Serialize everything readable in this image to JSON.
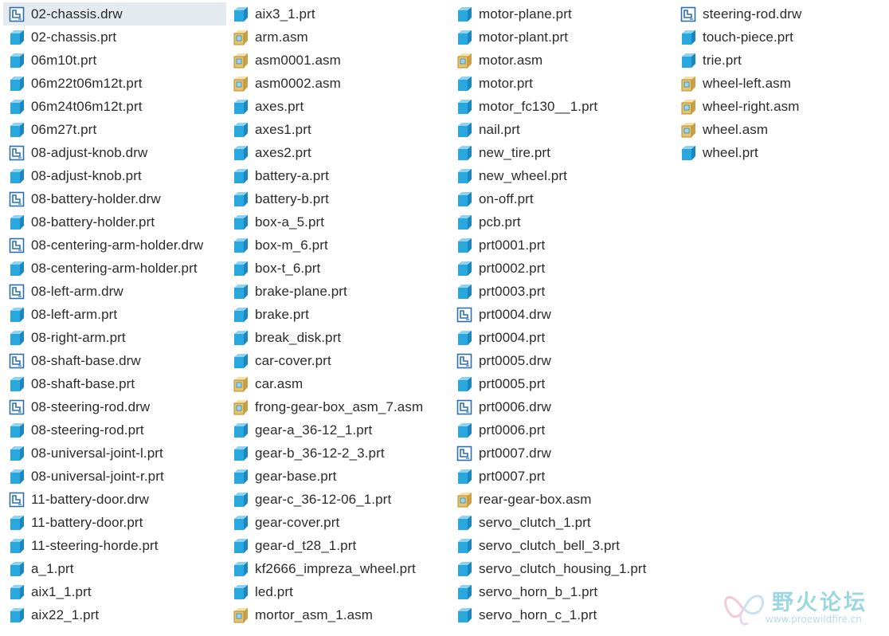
{
  "columns": [
    {
      "items": [
        {
          "name": "02-chassis.drw",
          "type": "drw",
          "selected": true
        },
        {
          "name": "02-chassis.prt",
          "type": "prt"
        },
        {
          "name": "06m10t.prt",
          "type": "prt"
        },
        {
          "name": "06m22t06m12t.prt",
          "type": "prt"
        },
        {
          "name": "06m24t06m12t.prt",
          "type": "prt"
        },
        {
          "name": "06m27t.prt",
          "type": "prt"
        },
        {
          "name": "08-adjust-knob.drw",
          "type": "drw"
        },
        {
          "name": "08-adjust-knob.prt",
          "type": "prt"
        },
        {
          "name": "08-battery-holder.drw",
          "type": "drw"
        },
        {
          "name": "08-battery-holder.prt",
          "type": "prt"
        },
        {
          "name": "08-centering-arm-holder.drw",
          "type": "drw"
        },
        {
          "name": "08-centering-arm-holder.prt",
          "type": "prt"
        },
        {
          "name": "08-left-arm.drw",
          "type": "drw"
        },
        {
          "name": "08-left-arm.prt",
          "type": "prt"
        },
        {
          "name": "08-right-arm.prt",
          "type": "prt"
        },
        {
          "name": "08-shaft-base.drw",
          "type": "drw"
        },
        {
          "name": "08-shaft-base.prt",
          "type": "prt"
        },
        {
          "name": "08-steering-rod.drw",
          "type": "drw"
        },
        {
          "name": "08-steering-rod.prt",
          "type": "prt"
        },
        {
          "name": "08-universal-joint-l.prt",
          "type": "prt"
        },
        {
          "name": "08-universal-joint-r.prt",
          "type": "prt"
        },
        {
          "name": "11-battery-door.drw",
          "type": "drw"
        },
        {
          "name": "11-battery-door.prt",
          "type": "prt"
        },
        {
          "name": "11-steering-horde.prt",
          "type": "prt"
        },
        {
          "name": "a_1.prt",
          "type": "prt"
        },
        {
          "name": "aix1_1.prt",
          "type": "prt"
        },
        {
          "name": "aix22_1.prt",
          "type": "prt"
        }
      ]
    },
    {
      "items": [
        {
          "name": "aix3_1.prt",
          "type": "prt"
        },
        {
          "name": "arm.asm",
          "type": "asm"
        },
        {
          "name": "asm0001.asm",
          "type": "asm"
        },
        {
          "name": "asm0002.asm",
          "type": "asm"
        },
        {
          "name": "axes.prt",
          "type": "prt"
        },
        {
          "name": "axes1.prt",
          "type": "prt"
        },
        {
          "name": "axes2.prt",
          "type": "prt"
        },
        {
          "name": "battery-a.prt",
          "type": "prt"
        },
        {
          "name": "battery-b.prt",
          "type": "prt"
        },
        {
          "name": "box-a_5.prt",
          "type": "prt"
        },
        {
          "name": "box-m_6.prt",
          "type": "prt"
        },
        {
          "name": "box-t_6.prt",
          "type": "prt"
        },
        {
          "name": "brake-plane.prt",
          "type": "prt"
        },
        {
          "name": "brake.prt",
          "type": "prt"
        },
        {
          "name": "break_disk.prt",
          "type": "prt"
        },
        {
          "name": "car-cover.prt",
          "type": "prt"
        },
        {
          "name": "car.asm",
          "type": "asm"
        },
        {
          "name": "frong-gear-box_asm_7.asm",
          "type": "asm"
        },
        {
          "name": "gear-a_36-12_1.prt",
          "type": "prt"
        },
        {
          "name": "gear-b_36-12-2_3.prt",
          "type": "prt"
        },
        {
          "name": "gear-base.prt",
          "type": "prt"
        },
        {
          "name": "gear-c_36-12-06_1.prt",
          "type": "prt"
        },
        {
          "name": "gear-cover.prt",
          "type": "prt"
        },
        {
          "name": "gear-d_t28_1.prt",
          "type": "prt"
        },
        {
          "name": "kf2666_impreza_wheel.prt",
          "type": "prt"
        },
        {
          "name": "led.prt",
          "type": "prt"
        },
        {
          "name": "mortor_asm_1.asm",
          "type": "asm"
        }
      ]
    },
    {
      "items": [
        {
          "name": "motor-plane.prt",
          "type": "prt"
        },
        {
          "name": "motor-plant.prt",
          "type": "prt"
        },
        {
          "name": "motor.asm",
          "type": "asm"
        },
        {
          "name": "motor.prt",
          "type": "prt"
        },
        {
          "name": "motor_fc130__1.prt",
          "type": "prt"
        },
        {
          "name": "nail.prt",
          "type": "prt"
        },
        {
          "name": "new_tire.prt",
          "type": "prt"
        },
        {
          "name": "new_wheel.prt",
          "type": "prt"
        },
        {
          "name": "on-off.prt",
          "type": "prt"
        },
        {
          "name": "pcb.prt",
          "type": "prt"
        },
        {
          "name": "prt0001.prt",
          "type": "prt"
        },
        {
          "name": "prt0002.prt",
          "type": "prt"
        },
        {
          "name": "prt0003.prt",
          "type": "prt"
        },
        {
          "name": "prt0004.drw",
          "type": "drw"
        },
        {
          "name": "prt0004.prt",
          "type": "prt"
        },
        {
          "name": "prt0005.drw",
          "type": "drw"
        },
        {
          "name": "prt0005.prt",
          "type": "prt"
        },
        {
          "name": "prt0006.drw",
          "type": "drw"
        },
        {
          "name": "prt0006.prt",
          "type": "prt"
        },
        {
          "name": "prt0007.drw",
          "type": "drw"
        },
        {
          "name": "prt0007.prt",
          "type": "prt"
        },
        {
          "name": "rear-gear-box.asm",
          "type": "asm"
        },
        {
          "name": "servo_clutch_1.prt",
          "type": "prt"
        },
        {
          "name": "servo_clutch_bell_3.prt",
          "type": "prt"
        },
        {
          "name": "servo_clutch_housing_1.prt",
          "type": "prt"
        },
        {
          "name": "servo_horn_b_1.prt",
          "type": "prt"
        },
        {
          "name": "servo_horn_c_1.prt",
          "type": "prt"
        }
      ]
    },
    {
      "items": [
        {
          "name": "steering-rod.drw",
          "type": "drw"
        },
        {
          "name": "touch-piece.prt",
          "type": "prt"
        },
        {
          "name": "trie.prt",
          "type": "prt"
        },
        {
          "name": "wheel-left.asm",
          "type": "asm"
        },
        {
          "name": "wheel-right.asm",
          "type": "asm"
        },
        {
          "name": "wheel.asm",
          "type": "asm"
        },
        {
          "name": "wheel.prt",
          "type": "prt"
        }
      ]
    }
  ],
  "icons": {
    "prt": "part-cube-icon",
    "asm": "assembly-icon",
    "drw": "drawing-icon"
  },
  "colors": {
    "part_cube": "#29a8e0",
    "assembly": "#e8c36a",
    "drawing_frame": "#2b6fb0",
    "selection": "#e5eaf0",
    "text": "#2b2b2b"
  },
  "watermark": {
    "title": "野火论坛",
    "url": "www.proewildfire.cn"
  }
}
